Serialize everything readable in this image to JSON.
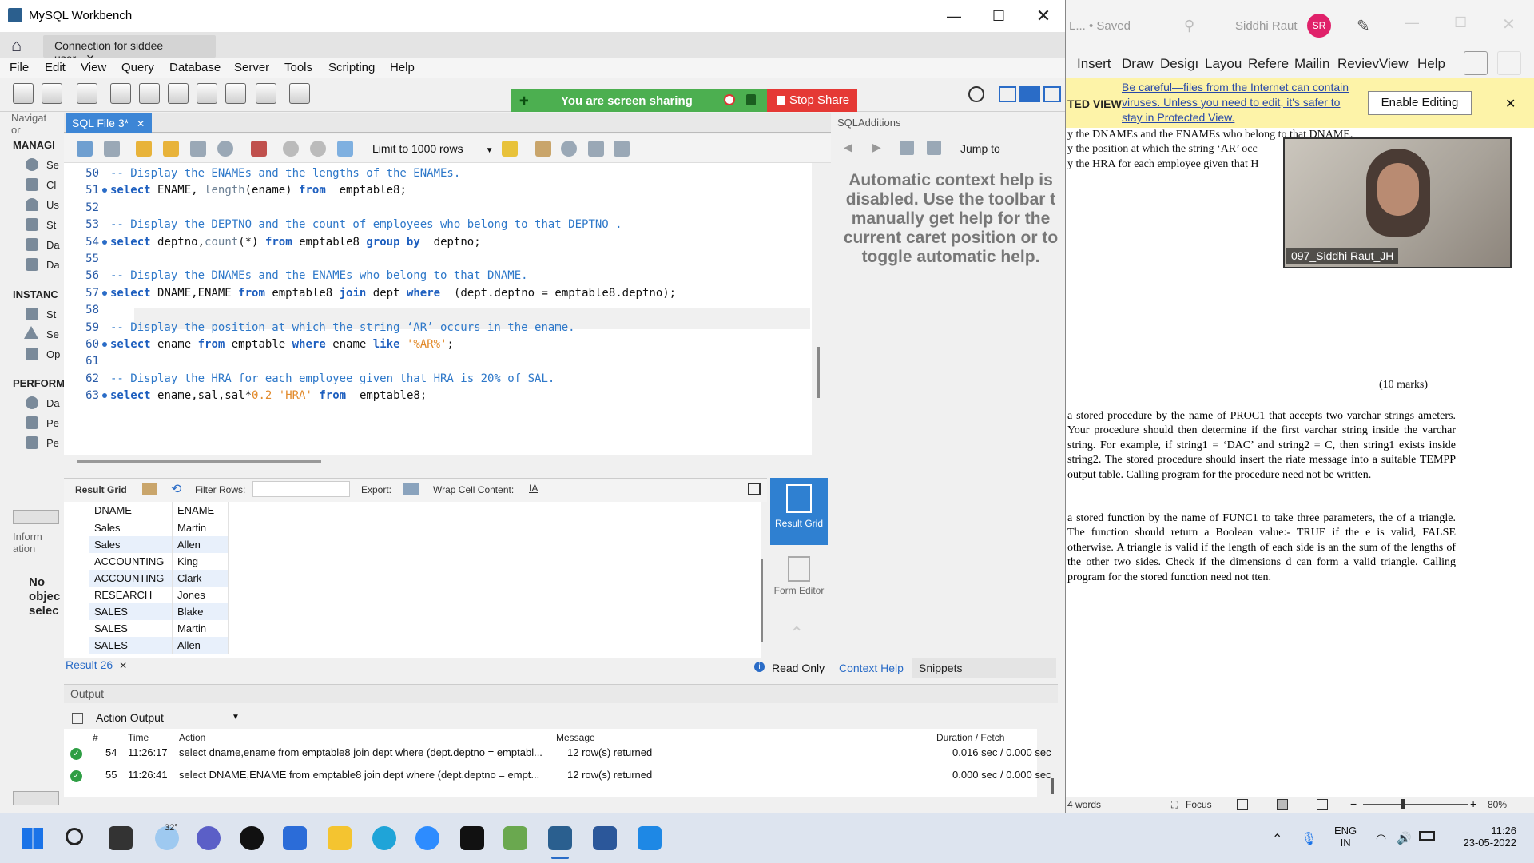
{
  "wb": {
    "title": "MySQL Workbench",
    "connection_tab": "Connection for siddee user",
    "menu": [
      "File",
      "Edit",
      "View",
      "Query",
      "Database",
      "Server",
      "Tools",
      "Scripting",
      "Help"
    ],
    "share_text": "You are screen sharing",
    "stop_share": "Stop Share",
    "nav": {
      "header": "Navigat or",
      "manage": "MANAGI",
      "manage_items": [
        "Se",
        "Cl",
        "Us",
        "St",
        "Da",
        "Da"
      ],
      "instance": "INSTANC",
      "instance_items": [
        "St",
        "Se",
        "Op"
      ],
      "perform": "PERFORM",
      "perform_items": [
        "Da",
        "Pe",
        "Pe"
      ],
      "info": "Inform ation",
      "noobj": "No objec selec"
    },
    "sql_tab": "SQL File 3*",
    "limit_label": "Limit to 1000 rows",
    "sqladd_title": "SQLAdditions",
    "jump_to": "Jump to",
    "context_help": "Automatic context help is disabled. Use the toolbar t manually get help for the current caret position or to toggle automatic help.",
    "context_help_tab": "Context Help",
    "snippets_tab": "Snippets",
    "result_grid_label": "Result Grid",
    "filter_rows": "Filter Rows:",
    "export": "Export:",
    "wrap": "Wrap Cell Content:",
    "side_result": "Result Grid",
    "side_form": "Form Editor",
    "read_only": "Read Only",
    "result_tab": "Result 26",
    "output_label": "Output",
    "action_output": "Action Output"
  },
  "code": [
    {
      "n": "50",
      "dot": false,
      "parts": [
        [
          "cm",
          "-- Display the ENAMEs and the lengths of the ENAMEs."
        ]
      ]
    },
    {
      "n": "51",
      "dot": true,
      "parts": [
        [
          "kw",
          "select"
        ],
        [
          "",
          "ENAME, "
        ],
        [
          "fn",
          "length"
        ],
        [
          "",
          "(ename) "
        ],
        [
          "kw",
          "from"
        ],
        [
          "",
          " emptable8;"
        ]
      ]
    },
    {
      "n": "52",
      "dot": false,
      "parts": []
    },
    {
      "n": "53",
      "dot": false,
      "parts": [
        [
          "cm",
          "-- Display the DEPTNO and the count of employees who belong to that DEPTNO ."
        ]
      ]
    },
    {
      "n": "54",
      "dot": true,
      "parts": [
        [
          "kw",
          "select"
        ],
        [
          "",
          "deptno,"
        ],
        [
          "fn",
          "count"
        ],
        [
          "",
          "(*) "
        ],
        [
          "kw",
          "from"
        ],
        [
          "",
          "emptable8 "
        ],
        [
          "kw",
          "group by"
        ],
        [
          "",
          " deptno;"
        ]
      ]
    },
    {
      "n": "55",
      "dot": false,
      "parts": []
    },
    {
      "n": "56",
      "dot": false,
      "parts": [
        [
          "cm",
          "-- Display the DNAMEs and the ENAMEs who belong to that DNAME."
        ]
      ]
    },
    {
      "n": "57",
      "dot": true,
      "parts": [
        [
          "kw",
          "select"
        ],
        [
          "",
          "DNAME,ENAME "
        ],
        [
          "kw",
          "from"
        ],
        [
          "",
          "emptable8 "
        ],
        [
          "kw",
          "join"
        ],
        [
          "",
          "dept "
        ],
        [
          "kw",
          "where"
        ],
        [
          "",
          " (dept.deptno = emptable8.deptno);"
        ]
      ]
    },
    {
      "n": "58",
      "dot": false,
      "parts": []
    },
    {
      "n": "59",
      "dot": false,
      "parts": [
        [
          "cm",
          "-- Display the position at which the string ‘AR’ occurs in the ename."
        ]
      ]
    },
    {
      "n": "60",
      "dot": true,
      "parts": [
        [
          "kw",
          "select"
        ],
        [
          "",
          "ename "
        ],
        [
          "kw",
          "from"
        ],
        [
          "",
          "emptable "
        ],
        [
          "kw",
          "where"
        ],
        [
          "",
          "ename "
        ],
        [
          "kw",
          "like"
        ],
        [
          "str",
          "'%AR%'"
        ],
        [
          "",
          ";"
        ]
      ]
    },
    {
      "n": "61",
      "dot": false,
      "parts": []
    },
    {
      "n": "62",
      "dot": false,
      "parts": [
        [
          "cm",
          "-- Display the HRA for each employee given that HRA is 20% of SAL."
        ]
      ]
    },
    {
      "n": "63",
      "dot": true,
      "parts": [
        [
          "kw",
          "select"
        ],
        [
          "",
          "ename,sal,sal*"
        ],
        [
          "str",
          "0.2"
        ],
        [
          "",
          " "
        ],
        [
          "str",
          "'HRA'"
        ],
        [
          "",
          " "
        ],
        [
          "kw",
          "from"
        ],
        [
          "",
          " emptable8;"
        ]
      ]
    }
  ],
  "grid": {
    "headers": [
      "DNAME",
      "ENAME"
    ],
    "rows": [
      [
        "Sales",
        "Martin"
      ],
      [
        "Sales",
        "Allen"
      ],
      [
        "ACCOUNTING",
        "King"
      ],
      [
        "ACCOUNTING",
        "Clark"
      ],
      [
        "RESEARCH",
        "Jones"
      ],
      [
        "SALES",
        "Blake"
      ],
      [
        "SALES",
        "Martin"
      ],
      [
        "SALES",
        "Allen"
      ]
    ]
  },
  "output": {
    "headers": [
      "#",
      "Time",
      "Action",
      "Message",
      "Duration / Fetch"
    ],
    "rows": [
      {
        "n": "54",
        "time": "11:26:17",
        "action": "select dname,ename from emptable8 join dept where (dept.deptno = emptabl...",
        "message": "12 row(s) returned",
        "duration": "0.016 sec / 0.000 sec"
      },
      {
        "n": "55",
        "time": "11:26:41",
        "action": "select DNAME,ENAME from emptable8 join dept where (dept.deptno = empt...",
        "message": "12 row(s) returned",
        "duration": "0.000 sec / 0.000 sec"
      }
    ]
  },
  "word": {
    "title_fragment": "L... • Saved",
    "user": "Siddhi Raut",
    "initials": "SR",
    "ribbon": [
      "Insert",
      "Draw",
      "Desigı",
      "Layou",
      "Refere",
      "Mailin",
      "Reviev",
      "View",
      "Help"
    ],
    "protected_label": "TED VIEW",
    "protected_msg": "Be careful—files from the Internet can contain viruses. Unless you need to edit, it's safer to stay in Protected View.",
    "enable_editing": "Enable Editing",
    "lines_top": [
      "y the DNAMEs and the ENAMEs who belong to that DNAME.",
      "y the position at which the string ‘AR’ occ",
      "y the HRA for each employee given that H"
    ],
    "marks": "(10 marks)",
    "para1": "a stored procedure by the name of PROC1 that accepts two varchar strings ameters. Your procedure should then determine if the first varchar string inside the varchar string. For example, if string1 = ‘DAC’ and string2 = C, then string1 exists inside string2. The stored procedure should insert the riate message into a suitable TEMPP output table. Calling program for the procedure need not be written.",
    "para2": "a stored function by the name of FUNC1 to take three parameters, the of a triangle. The function should return a Boolean value:- TRUE if the e is valid, FALSE otherwise. A triangle is valid if the length of each side is an the sum of the lengths of the other two sides. Check if the dimensions d can form a valid triangle. Calling program for the stored function need not tten.",
    "cam_name": "097_Siddhi Raut_JH",
    "status_words": "4 words",
    "focus": "Focus",
    "zoom": "80%"
  },
  "taskbar": {
    "weather": "32°",
    "lang1": "ENG",
    "lang2": "IN",
    "time": "11:26",
    "date": "23-05-2022"
  }
}
